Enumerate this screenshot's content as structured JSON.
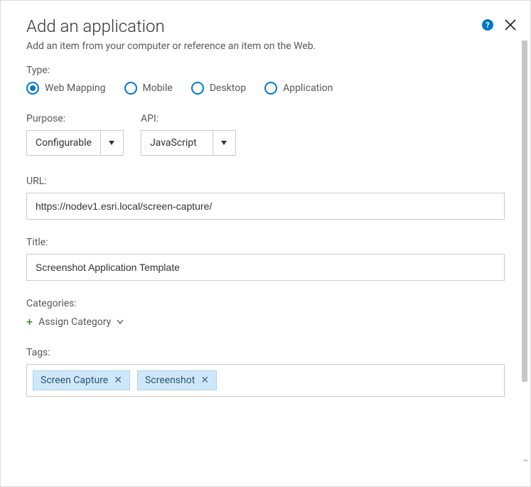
{
  "dialog": {
    "title": "Add an application",
    "subtitle": "Add an item from your computer or reference an item on the Web."
  },
  "type": {
    "label": "Type:",
    "options": [
      {
        "label": "Web Mapping",
        "selected": true
      },
      {
        "label": "Mobile",
        "selected": false
      },
      {
        "label": "Desktop",
        "selected": false
      },
      {
        "label": "Application",
        "selected": false
      }
    ]
  },
  "purpose": {
    "label": "Purpose:",
    "value": "Configurable"
  },
  "api": {
    "label": "API:",
    "value": "JavaScript"
  },
  "url": {
    "label": "URL:",
    "value": "https://nodev1.esri.local/screen-capture/"
  },
  "title_field": {
    "label": "Title:",
    "value": "Screenshot Application Template"
  },
  "categories": {
    "label": "Categories:",
    "assign_label": "Assign Category"
  },
  "tags": {
    "label": "Tags:",
    "values": [
      "Screen Capture",
      "Screenshot"
    ]
  }
}
